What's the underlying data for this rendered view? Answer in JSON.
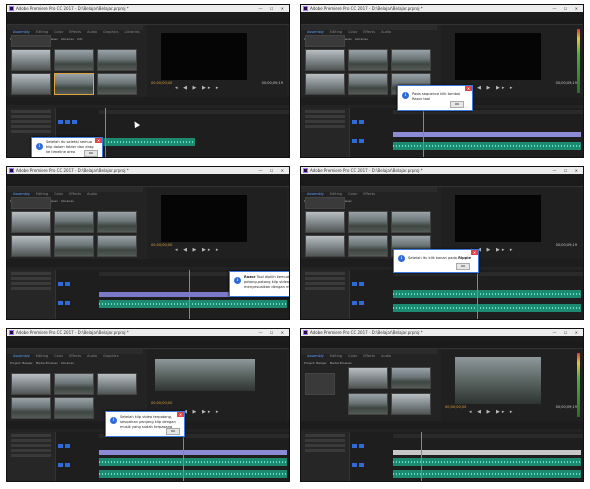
{
  "app": {
    "title": "Adobe Premiere Pro CC 2017 - D:\\Belajar\\Belajar.prproj *",
    "window_controls": "—  ☐  ✕"
  },
  "menu": [
    "File",
    "Edit",
    "Clip",
    "Sequence",
    "Marker",
    "Title",
    "Window",
    "Help"
  ],
  "workspaces": [
    "Assembly",
    "Editing",
    "Color",
    "Effects",
    "Audio",
    "Graphics",
    "Libraries"
  ],
  "project_tabs": [
    "Project: Belajar",
    "Media Browser",
    "Libraries",
    "Info",
    "Effects"
  ],
  "monitor": {
    "timecode_left": "00;00;00;00",
    "timecode_right": "00;00;09;19",
    "controls": "◂ ◀ ▶ ▶▸ ▸"
  },
  "tools": "↖ ⇥ ↔ ✂ ↦ ✎ ✋ T",
  "dialogs": [
    {
      "text": "Setelah itu seleksi semua klip dalam folder dan drag ke timeline area"
    },
    {
      "text": "Pada sequence klik tombol Razor tool"
    },
    {
      "text_before": "Setelah",
      "text_bold": "Razor",
      "text_after": "Tool dipilih kemudian potong-potong klip video",
      "text_line2": "untuk menyesuaikan dengan musiknya"
    },
    {
      "text_before": "Setelah itu klik kanan pada",
      "text_bold": "Ripple",
      "text_after": ""
    },
    {
      "text": "Setelah klip video terpotong, sesuaikan panjang klip dengan musik yang sudah terpasang"
    }
  ],
  "ok_label": "OK",
  "icons": {
    "info": "information-icon",
    "close": "close-icon"
  }
}
